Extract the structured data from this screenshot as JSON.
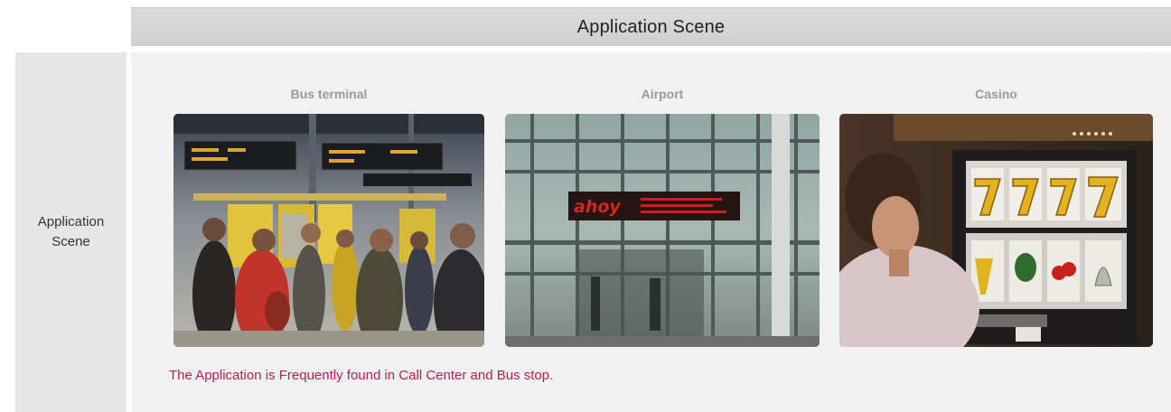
{
  "header": {
    "title": "Application Scene"
  },
  "row": {
    "label": "Application Scene"
  },
  "scenes": [
    {
      "label": "Bus terminal",
      "icon": "bus-terminal-photo"
    },
    {
      "label": "Airport",
      "icon": "airport-photo"
    },
    {
      "label": "Casino",
      "icon": "casino-photo"
    }
  ],
  "airport_sign": {
    "brand": "ahoy"
  },
  "note": "The Application is Frequently found in Call Center and Bus stop.",
  "colors": {
    "header_bg": "#d4d4d4",
    "cell_bg": "#f1f1f1",
    "label_cell_bg": "#e6e6e6",
    "note": "#c01c54",
    "scene_label": "#9a9a9a"
  }
}
